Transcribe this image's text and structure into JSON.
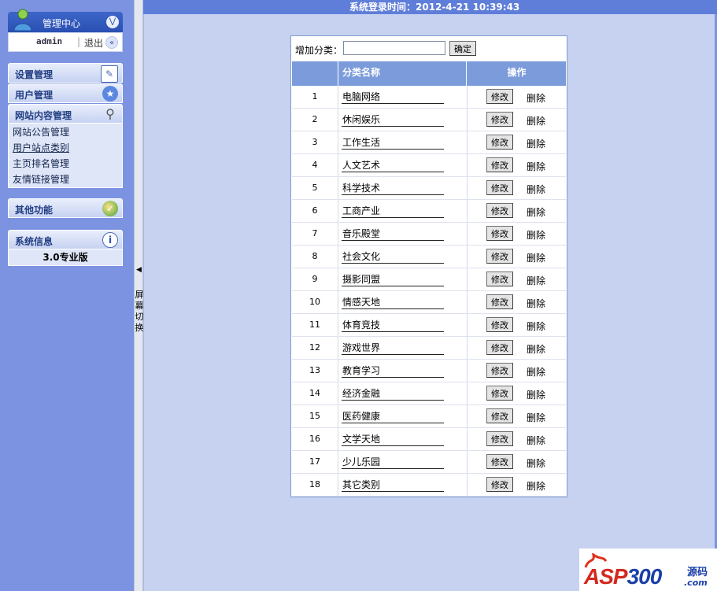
{
  "topbar": {
    "login_time_label": "系统登录时间：2012-4-21 10:39:43"
  },
  "sidebar": {
    "header": {
      "title": "管理中心",
      "collapse_icon": "double-chevron-down-icon"
    },
    "user": {
      "name": "admin",
      "separator": "|",
      "logout": "退出",
      "collapse_icon": "double-chevron-left-icon"
    },
    "sections": {
      "settings": {
        "title": "设置管理",
        "icon": "edit-icon"
      },
      "users": {
        "title": "用户管理",
        "icon": "users-icon"
      },
      "content": {
        "title": "网站内容管理",
        "icon": "search-icon",
        "items": [
          "网站公告管理",
          "用户站点类别",
          "主页排名管理",
          "友情链接管理"
        ]
      },
      "other": {
        "title": "其他功能",
        "icon": "globe-icon"
      },
      "system": {
        "title": "系统信息",
        "icon": "info-icon",
        "version": "3.0专业版"
      }
    }
  },
  "splitter": {
    "label": "屏\n幕\n切\n换",
    "arrow_icon": "triangle-left-icon"
  },
  "content": {
    "add": {
      "label": "增加分类：",
      "value": "",
      "submit": "确定"
    },
    "table": {
      "headers": {
        "num": "",
        "name": "分类名称",
        "ops": "操作"
      },
      "modify_label": "修改",
      "delete_label": "删除",
      "rows": [
        {
          "num": "1",
          "name": "电脑网络"
        },
        {
          "num": "2",
          "name": "休闲娱乐"
        },
        {
          "num": "3",
          "name": "工作生活"
        },
        {
          "num": "4",
          "name": "人文艺术"
        },
        {
          "num": "5",
          "name": "科学技术"
        },
        {
          "num": "6",
          "name": "工商产业"
        },
        {
          "num": "7",
          "name": "音乐殿堂"
        },
        {
          "num": "8",
          "name": "社会文化"
        },
        {
          "num": "9",
          "name": "摄影同盟"
        },
        {
          "num": "10",
          "name": "情感天地"
        },
        {
          "num": "11",
          "name": "体育竞技"
        },
        {
          "num": "12",
          "name": "游戏世界"
        },
        {
          "num": "13",
          "name": "教育学习"
        },
        {
          "num": "14",
          "name": "经济金融"
        },
        {
          "num": "15",
          "name": "医药健康"
        },
        {
          "num": "16",
          "name": "文学天地"
        },
        {
          "num": "17",
          "name": "少儿乐园"
        },
        {
          "num": "18",
          "name": "其它类别"
        }
      ]
    }
  },
  "watermark": {
    "brand_red": "ASP",
    "brand_blue": "300",
    "code": "源码",
    "domain": ".com"
  }
}
